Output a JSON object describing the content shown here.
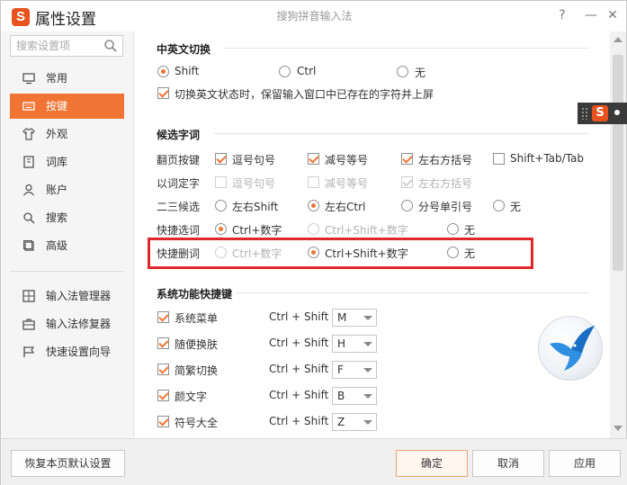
{
  "window": {
    "app_title": "属性设置",
    "center_title": "搜狗拼音输入法",
    "help_label": "?",
    "minimize_label": "—",
    "close_label": "✕",
    "logo_letter": "S"
  },
  "sidebar": {
    "search_placeholder": "搜索设置项",
    "items": [
      {
        "label": "常用",
        "icon": "monitor-icon"
      },
      {
        "label": "按键",
        "icon": "keyboard-icon",
        "active": true
      },
      {
        "label": "外观",
        "icon": "shirt-icon"
      },
      {
        "label": "词库",
        "icon": "book-icon"
      },
      {
        "label": "账户",
        "icon": "user-icon"
      },
      {
        "label": "搜索",
        "icon": "search-icon"
      },
      {
        "label": "高级",
        "icon": "square-icon"
      }
    ],
    "tools": [
      {
        "label": "输入法管理器",
        "icon": "grid-icon"
      },
      {
        "label": "输入法修复器",
        "icon": "toolbox-icon"
      },
      {
        "label": "快速设置向导",
        "icon": "flag-icon"
      }
    ]
  },
  "sections": {
    "switch": {
      "title": "中英文切换",
      "options": [
        "Shift",
        "Ctrl",
        "无"
      ],
      "selected": "Shift",
      "commit_label": "切换英文状态时，保留输入窗口中已存在的字符并上屏",
      "commit_checked": true
    },
    "candidates": {
      "title": "候选字词",
      "page_keys": {
        "label": "翻页按键",
        "options": [
          {
            "label": "逗号句号",
            "checked": true
          },
          {
            "label": "减号等号",
            "checked": true
          },
          {
            "label": "左右方括号",
            "checked": true
          },
          {
            "label": "Shift+Tab/Tab",
            "checked": false
          }
        ]
      },
      "word_to_char": {
        "label": "以词定字",
        "options": [
          {
            "label": "逗号句号",
            "checked": false
          },
          {
            "label": "减号等号",
            "checked": false
          },
          {
            "label": "左右方括号",
            "checked": true
          }
        ]
      },
      "second_third": {
        "label": "二三候选",
        "options": [
          "左右Shift",
          "左右Ctrl",
          "分号单引号",
          "无"
        ],
        "selected": "左右Ctrl"
      },
      "quick_select": {
        "label": "快捷选词",
        "options": [
          "Ctrl+数字",
          "Ctrl+Shift+数字",
          "无"
        ],
        "selected": "Ctrl+数字"
      },
      "quick_delete": {
        "label": "快捷删词",
        "options": [
          "Ctrl+数字",
          "Ctrl+Shift+数字",
          "无"
        ],
        "selected": "Ctrl+Shift+数字"
      }
    },
    "shortcuts": {
      "title": "系统功能快捷键",
      "prefix": "Ctrl + Shift +",
      "items": [
        {
          "label": "系统菜单",
          "key": "M",
          "checked": true
        },
        {
          "label": "随便换肤",
          "key": "H",
          "checked": true
        },
        {
          "label": "简繁切换",
          "key": "F",
          "checked": true
        },
        {
          "label": "颜文字",
          "key": "B",
          "checked": true
        },
        {
          "label": "符号大全",
          "key": "Z",
          "checked": true
        }
      ]
    }
  },
  "footer": {
    "restore_label": "恢复本页默认设置",
    "ok_label": "确定",
    "cancel_label": "取消",
    "apply_label": "应用"
  },
  "colors": {
    "accent": "#f07534",
    "highlight_border": "#e0282c",
    "logo": "#e8521e"
  }
}
